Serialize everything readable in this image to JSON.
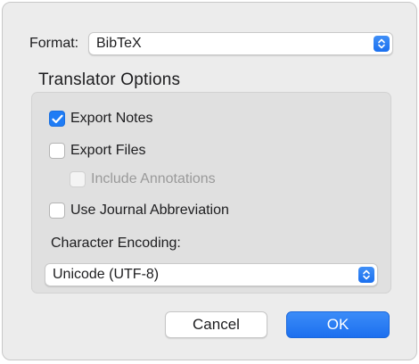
{
  "format": {
    "label": "Format:",
    "selected": "BibTeX",
    "popup_icon": "updown-chevron-icon"
  },
  "translator_options": {
    "title": "Translator Options",
    "export_notes": {
      "label": "Export Notes",
      "checked": true
    },
    "export_files": {
      "label": "Export Files",
      "checked": false
    },
    "include_annotations": {
      "label": "Include Annotations",
      "checked": false,
      "enabled": false
    },
    "use_journal_abbreviation": {
      "label": "Use Journal Abbreviation",
      "checked": false
    },
    "character_encoding": {
      "label": "Character Encoding:",
      "selected": "Unicode (UTF-8)",
      "popup_icon": "updown-chevron-icon"
    }
  },
  "buttons": {
    "cancel": "Cancel",
    "ok": "OK"
  },
  "colors": {
    "accent": "#1f7cf5",
    "dialog_bg": "#ececec",
    "group_bg": "#e0e0e0",
    "disabled_text": "#9a9a9a"
  }
}
